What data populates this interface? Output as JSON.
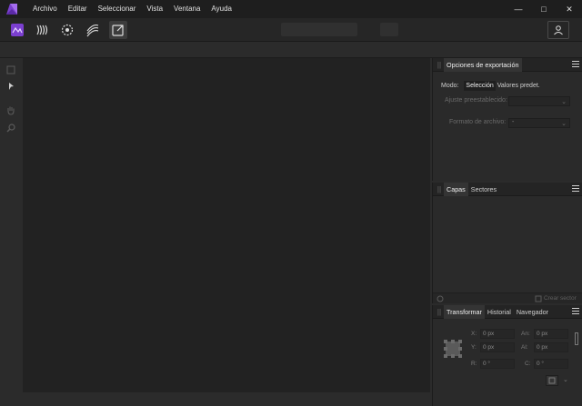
{
  "menu": {
    "items": [
      "Archivo",
      "Editar",
      "Seleccionar",
      "Vista",
      "Ventana",
      "Ayuda"
    ]
  },
  "window_controls": {
    "minimize": "—",
    "maximize": "□",
    "close": "✕"
  },
  "toolbar": {
    "personas": [
      "photo-persona-icon",
      "liquify-persona-icon",
      "develop-persona-icon",
      "tone-mapping-persona-icon",
      "export-persona-icon"
    ],
    "active_persona": "export-persona-icon",
    "accent_color": "#8a4fd6"
  },
  "export_panel": {
    "title": "Opciones de exportación",
    "mode_label": "Modo:",
    "mode_selection": "Selección",
    "mode_presets": "Valores predet.",
    "preset_label": "Ajuste preestablecido:",
    "format_label": "Formato de archivo:",
    "format_value": "-"
  },
  "layers_panel": {
    "tabs": [
      "Capas",
      "Sectores"
    ],
    "create_slice": "Crear sector"
  },
  "transform_panel": {
    "tabs": [
      "Transformar",
      "Historial",
      "Navegador"
    ],
    "x_label": "X:",
    "x_value": "0 px",
    "y_label": "Y:",
    "y_value": "0 px",
    "w_label": "An:",
    "w_value": "0 px",
    "h_label": "Al:",
    "h_value": "0 px",
    "r_label": "R:",
    "r_value": "0 °",
    "s_label": "C:",
    "s_value": "0 °"
  }
}
